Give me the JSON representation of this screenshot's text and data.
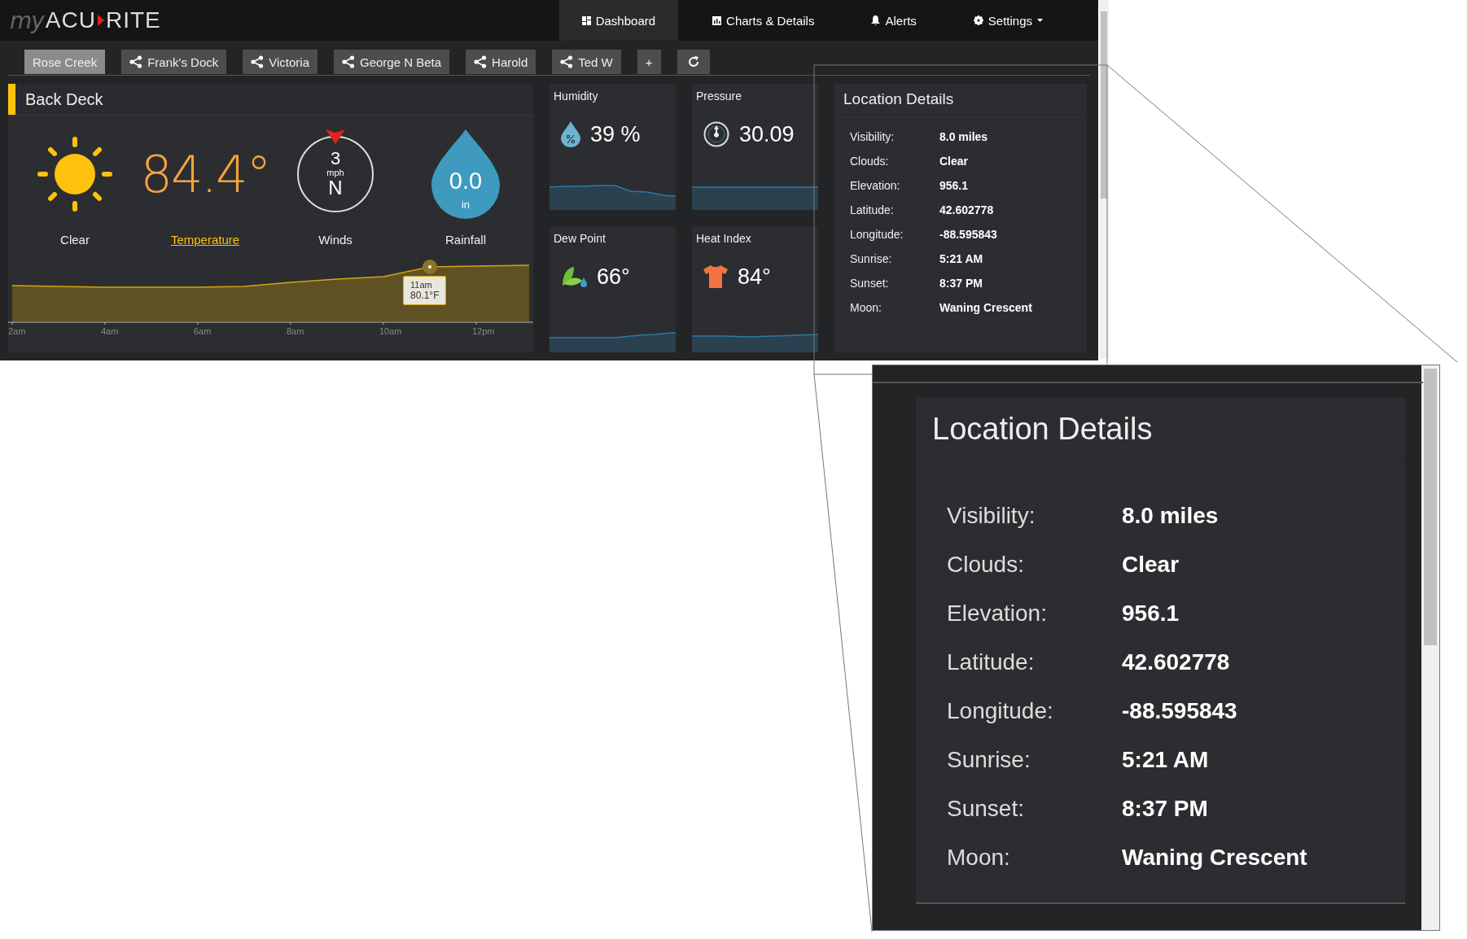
{
  "logo": {
    "prefix": "my",
    "name_start": "ACU",
    "name_end": "RITE"
  },
  "nav": [
    {
      "label": "Dashboard",
      "selected": true,
      "dropdown": false
    },
    {
      "label": "Charts & Details",
      "selected": false,
      "dropdown": false
    },
    {
      "label": "Alerts",
      "selected": false,
      "dropdown": false
    },
    {
      "label": "Settings",
      "selected": false,
      "dropdown": true
    }
  ],
  "locations": [
    {
      "label": "Rose Creek",
      "selected": true,
      "shared": false
    },
    {
      "label": "Frank's Dock",
      "selected": false,
      "shared": true
    },
    {
      "label": "Victoria",
      "selected": false,
      "shared": true
    },
    {
      "label": "George N Beta",
      "selected": false,
      "shared": true
    },
    {
      "label": "Harold",
      "selected": false,
      "shared": true
    },
    {
      "label": "Ted W",
      "selected": false,
      "shared": true
    }
  ],
  "add_button": "+",
  "station": {
    "name": "Back Deck",
    "condition": "Clear",
    "temperature": "84.4°",
    "temperature_label": "Temperature",
    "wind_speed": "3",
    "wind_unit": "mph",
    "wind_direction": "N",
    "wind_label": "Winds",
    "rain": "0.0",
    "rain_unit": "in",
    "rain_label": "Rainfall",
    "chart": {
      "x_labels": [
        "2am",
        "4am",
        "6am",
        "8am",
        "10am",
        "12pm"
      ],
      "tooltip_time": "11am",
      "tooltip_value": "80.1°F"
    }
  },
  "tiles": [
    {
      "title": "Humidity",
      "value": "39 %"
    },
    {
      "title": "Pressure",
      "value": "30.09"
    },
    {
      "title": "Dew Point",
      "value": "66°"
    },
    {
      "title": "Heat Index",
      "value": "84°"
    }
  ],
  "location_details": {
    "title": "Location Details",
    "rows": [
      {
        "label": "Visibility:",
        "value": "8.0 miles"
      },
      {
        "label": "Clouds:",
        "value": "Clear"
      },
      {
        "label": "Elevation:",
        "value": "956.1"
      },
      {
        "label": "Latitude:",
        "value": "42.602778"
      },
      {
        "label": "Longitude:",
        "value": "-88.595843"
      },
      {
        "label": "Sunrise:",
        "value": "5:21 AM"
      },
      {
        "label": "Sunset:",
        "value": "8:37 PM"
      },
      {
        "label": "Moon:",
        "value": "Waning Crescent"
      }
    ]
  },
  "magnified_details": {
    "title": "Location Details",
    "rows": [
      {
        "label": "Visibility:",
        "value": "8.0 miles"
      },
      {
        "label": "Clouds:",
        "value": "Clear"
      },
      {
        "label": "Elevation:",
        "value": "956.1"
      },
      {
        "label": "Latitude:",
        "value": "42.602778"
      },
      {
        "label": "Longitude:",
        "value": "-88.595843"
      },
      {
        "label": "Sunrise:",
        "value": "5:21 AM"
      },
      {
        "label": "Sunset:",
        "value": "8:37 PM"
      },
      {
        "label": "Moon:",
        "value": "Waning Crescent"
      }
    ]
  }
}
